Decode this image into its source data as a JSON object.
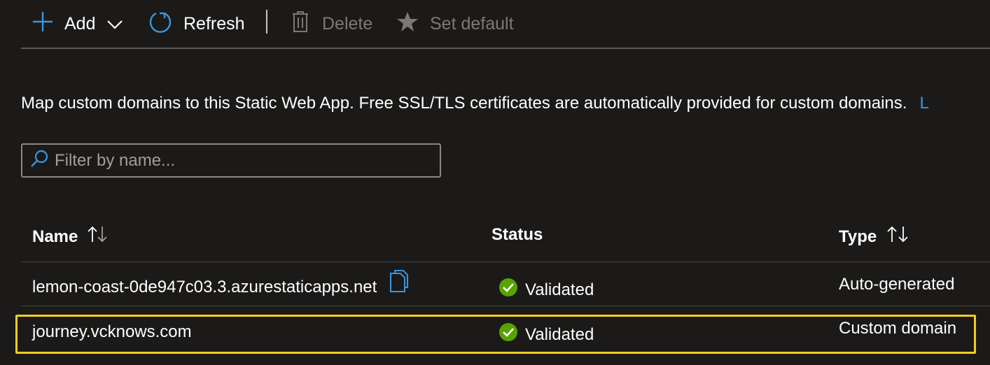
{
  "toolbar": {
    "add_label": "Add",
    "refresh_label": "Refresh",
    "delete_label": "Delete",
    "set_default_label": "Set default"
  },
  "description": {
    "text": "Map custom domains to this Static Web App. Free SSL/TLS certificates are automatically provided for custom domains.",
    "link_text": "L"
  },
  "filter": {
    "placeholder": "Filter by name..."
  },
  "table": {
    "columns": [
      "Name",
      "Status",
      "Type"
    ],
    "rows": [
      {
        "name": "lemon-coast-0de947c03.3.azurestaticapps.net",
        "status": "Validated",
        "type": "Auto-generated"
      },
      {
        "name": "journey.vcknows.com",
        "status": "Validated",
        "type": "Custom domain"
      }
    ]
  },
  "colors": {
    "accent": "#3a96dd",
    "success": "#57a300",
    "highlight": "#f4cd1f",
    "background": "#1b1a19"
  },
  "icons": {
    "add": "plus-icon",
    "add_dropdown": "chevron-down-icon",
    "refresh": "refresh-icon",
    "delete": "trash-icon",
    "set_default": "star-icon",
    "filter": "search-icon",
    "copy": "copy-icon",
    "status": "check-circle-icon",
    "sort": "sort-arrows-icon"
  }
}
